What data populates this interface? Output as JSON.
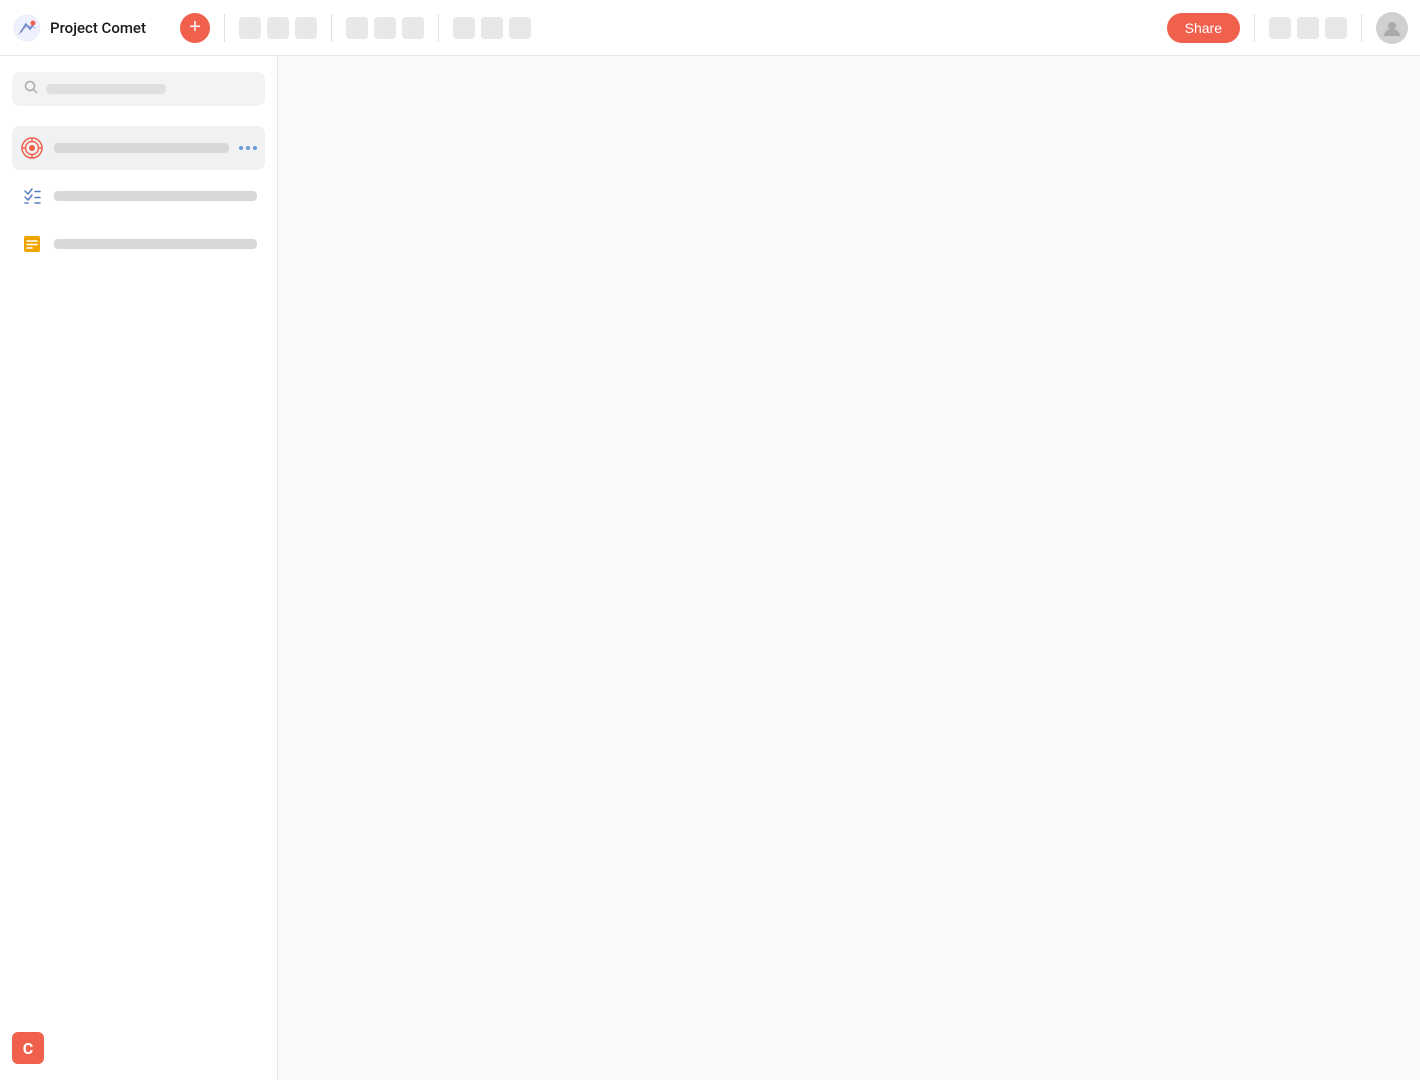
{
  "header": {
    "title": "Project Comet",
    "add_button_label": "+",
    "share_label": "Share",
    "toolbar_groups": [
      {
        "buttons": 3
      },
      {
        "buttons": 3
      },
      {
        "buttons": 3
      }
    ]
  },
  "sidebar": {
    "search_placeholder": "",
    "items": [
      {
        "id": "goals",
        "label": "",
        "label_width": 130,
        "icon_type": "target",
        "active": true,
        "has_more": true
      },
      {
        "id": "tasks",
        "label": "",
        "label_width": 80,
        "icon_type": "checklist",
        "active": false,
        "has_more": false
      },
      {
        "id": "notes",
        "label": "",
        "label_width": 80,
        "icon_type": "note",
        "active": false,
        "has_more": false
      }
    ],
    "bottom_logo": "C"
  },
  "main": {
    "background": "#fafafa"
  }
}
